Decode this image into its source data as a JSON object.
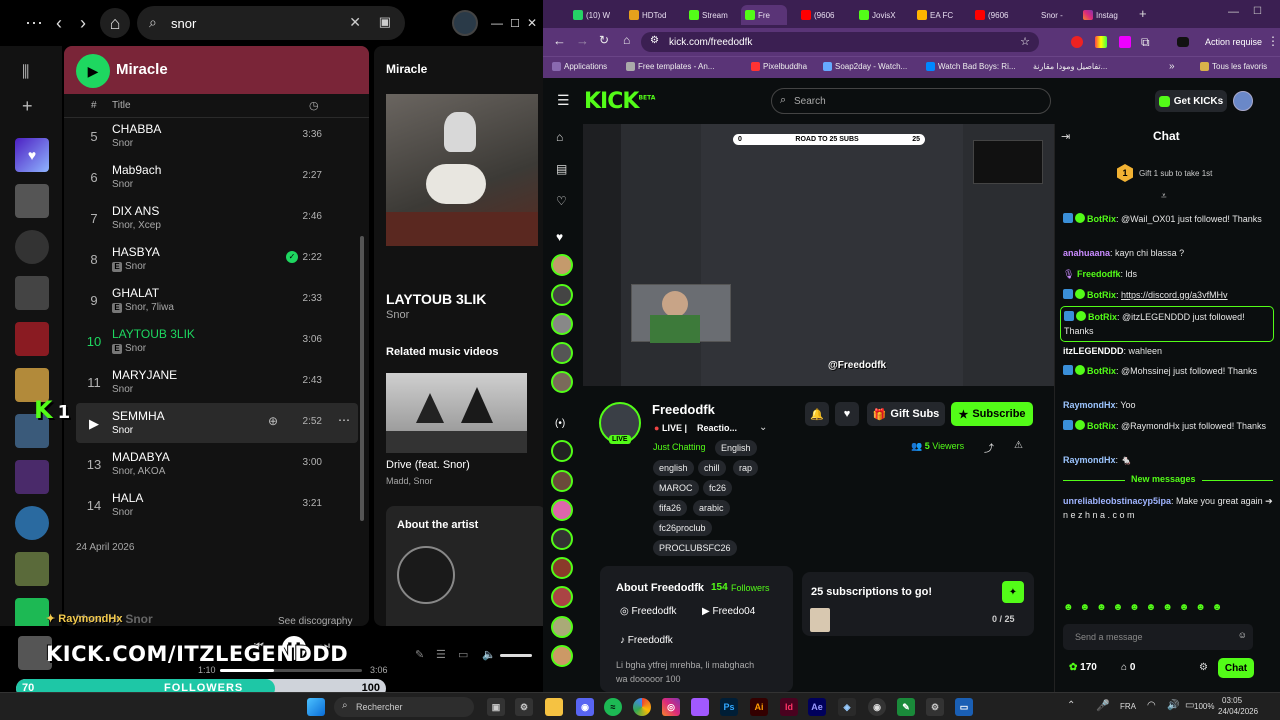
{
  "spotify": {
    "search_value": "snor",
    "playlist_title": "Miracle",
    "col_num": "#",
    "col_title": "Title",
    "tracks": [
      {
        "num": "5",
        "title": "CHABBA",
        "artist": "Snor",
        "explicit": false,
        "duration": "3:36"
      },
      {
        "num": "6",
        "title": "Mab9ach",
        "artist": "Snor",
        "explicit": false,
        "duration": "2:27"
      },
      {
        "num": "7",
        "title": "DIX ANS",
        "artist": "Snor, Xcep",
        "explicit": false,
        "duration": "2:46"
      },
      {
        "num": "8",
        "title": "HASBYA",
        "artist": "Snor",
        "explicit": true,
        "duration": "2:22"
      },
      {
        "num": "9",
        "title": "GHALAT",
        "artist": "Snor, 7liwa",
        "explicit": true,
        "duration": "2:33"
      },
      {
        "num": "10",
        "title": "LAYTOUB 3LIK",
        "artist": "Snor",
        "explicit": true,
        "duration": "3:06"
      },
      {
        "num": "11",
        "title": "MARYJANE",
        "artist": "Snor",
        "explicit": false,
        "duration": "2:43"
      },
      {
        "num": "12",
        "title": "SEMMHA",
        "artist": "Snor",
        "explicit": false,
        "duration": "2:52"
      },
      {
        "num": "13",
        "title": "MADABYA",
        "artist": "Snor, AKOA",
        "explicit": false,
        "duration": "3:00"
      },
      {
        "num": "14",
        "title": "HALA",
        "artist": "Snor",
        "explicit": false,
        "duration": "3:21"
      }
    ],
    "release_date": "24 April 2026",
    "more_by": "More by Snor",
    "see_discography": "See discography",
    "right_panel": {
      "album": "Miracle",
      "now_title": "LAYTOUB 3LIK",
      "now_artist": "Snor",
      "related_heading": "Related music videos",
      "video_title": "Drive (feat. Snor)",
      "video_artist": "Madd, Snor",
      "about_artist": "About the artist"
    },
    "player": {
      "elapsed": "1:10",
      "total": "3:06",
      "progress": 0.38
    },
    "overlay": {
      "follower_name": "RaymondHx",
      "kick_url": "KICK.COM/ITZLEGENDDD",
      "bar_min": "70",
      "bar_label": "FOLLOWERS",
      "bar_max": "100",
      "bar_value": 70,
      "kick_k": "K",
      "kick_k_num": "1"
    }
  },
  "browser": {
    "tabs": [
      "(10) W",
      "HDTod",
      "Stream",
      "Fre",
      "(9606",
      "JovisX",
      "EA FC",
      "(9606",
      "Snor -",
      "Instag"
    ],
    "url": "kick.com/freedodfk",
    "action_label": "Action requise",
    "bookmarks": [
      "Applications",
      "Free templates - An...",
      "Pixelbuddha",
      "Soap2day - Watch...",
      "Watch Bad Boys: Ri...",
      "تفاصيل ومودا مقارنة...",
      "Tous les favoris"
    ]
  },
  "kick": {
    "logo": "KICK",
    "logo_beta": "BETA",
    "search_placeholder": "Search",
    "get_kicks": "Get KICKs",
    "chat_title": "Chat",
    "gift_text": "Gift 1 sub to take 1st",
    "gift_count": "1",
    "stream_overlay": {
      "goal": "ROAD TO 25 SUBS",
      "goal_min": "0",
      "goal_max": "25",
      "handle": "@Freedodfk"
    },
    "channel": {
      "name": "Freedodfk",
      "live_label": "LIVE",
      "live_text": "LIVE",
      "stream_title": "Reactio...",
      "category": "Just Chatting",
      "language": "English",
      "tags": [
        "english",
        "chill",
        "rap",
        "MAROC",
        "fc26",
        "fifa26",
        "arabic",
        "fc26proclub",
        "PROCLUBSFC26"
      ],
      "viewers": "5",
      "viewers_label": "Viewers",
      "gift_subs": "Gift Subs",
      "subscribe": "Subscribe"
    },
    "about": {
      "heading": "About Freedodfk",
      "followers": "154",
      "followers_label": "Followers",
      "instagram": "Freedodfk",
      "youtube": "Freedo04",
      "tiktok": "Freedodfk",
      "bio_1": "Li bgha ytfrej mrehba, li mabghach",
      "bio_2": "wa dooooor 100"
    },
    "subs_goal": {
      "text": "25 subscriptions to go!",
      "progress": "0 / 25"
    },
    "chat": [
      {
        "user": "BotRix",
        "color": "#53fc18",
        "bot": true,
        "text": "@Wail_OX01 just followed! Thanks"
      },
      {
        "user": "anahuaana",
        "color": "#c98bff",
        "bot": false,
        "text": "kayn chi blassa ?"
      },
      {
        "user": "Freedodfk",
        "color": "#53fc18",
        "bot": false,
        "text": "lds"
      },
      {
        "user": "BotRix",
        "color": "#53fc18",
        "bot": true,
        "text": "https://discord.gg/a3vfMHv"
      },
      {
        "user": "BotRix",
        "color": "#53fc18",
        "bot": true,
        "text": "@itzLEGENDDD just followed! Thanks"
      },
      {
        "user": "itzLEGENDDD",
        "color": "#ffffff",
        "bot": false,
        "text": "wahleen"
      },
      {
        "user": "BotRix",
        "color": "#53fc18",
        "bot": true,
        "text": "@Mohssinej just followed! Thanks"
      },
      {
        "user": "RaymondHx",
        "color": "#9cc5ff",
        "bot": false,
        "text": "Yoo"
      },
      {
        "user": "BotRix",
        "color": "#53fc18",
        "bot": true,
        "text": "@RaymondHx just followed! Thanks"
      },
      {
        "user": "RaymondHx",
        "color": "#9cc5ff",
        "bot": false,
        "text": "🐁"
      }
    ],
    "new_messages": "New messages",
    "last_msg": {
      "user": "unreliableobstinacyp5ipa",
      "text": "Make you great again ➔ n e z h n a . c o m"
    },
    "send_placeholder": "Send a message",
    "kicks_count": "170",
    "other_count": "0",
    "chat_button": "Chat"
  },
  "taskbar": {
    "search": "Rechercher",
    "lang": "FRA",
    "battery": "100%",
    "time": "03:05",
    "date": "24/04/2026"
  }
}
